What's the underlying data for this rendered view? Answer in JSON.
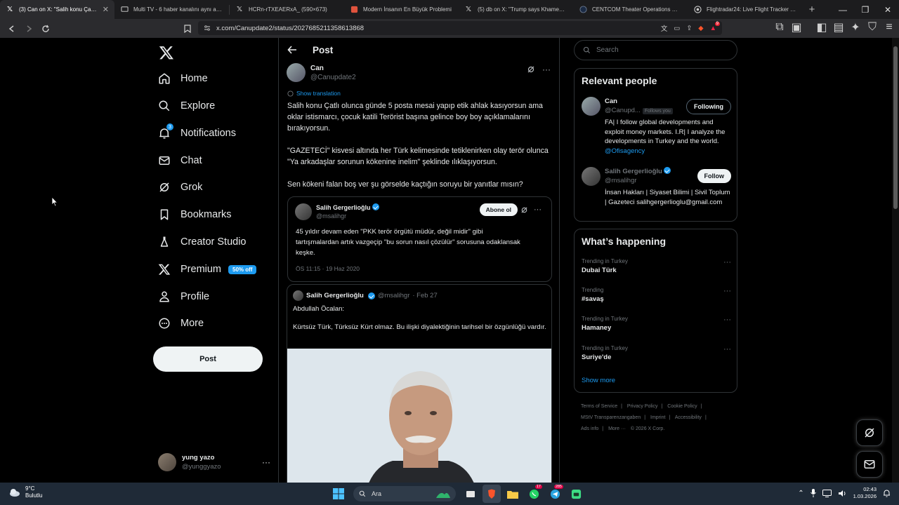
{
  "browser": {
    "tabs": [
      {
        "title": "(3) Can on X: \"Salih konu Çatlı olunca",
        "favicon": "x-icon",
        "active": true
      },
      {
        "title": "Multi TV - 6 haber kanalını aynı anda",
        "favicon": "tv-icon",
        "active": false
      },
      {
        "title": "HCRn-rTXEAERxA_ (590×673)",
        "favicon": "x-icon",
        "active": false
      },
      {
        "title": "Modern İnsanın En Büyük Problemi",
        "favicon": "page-icon",
        "active": false
      },
      {
        "title": "(5) db on X: \"Trump says Khamenei is",
        "favicon": "x-icon",
        "active": false
      },
      {
        "title": "CENTCOM Theater Operations Map",
        "favicon": "globe-icon",
        "active": false
      },
      {
        "title": "Flightradar24: Live Flight Tracker - Re",
        "favicon": "radar-icon",
        "active": false
      }
    ],
    "url": "x.com/Canupdate2/status/2027685211358613868",
    "shield_badge": "9"
  },
  "sidebar": {
    "nav": [
      {
        "label": "Home",
        "icon": "home-icon"
      },
      {
        "label": "Explore",
        "icon": "search-icon"
      },
      {
        "label": "Notifications",
        "icon": "bell-icon",
        "badge": "3"
      },
      {
        "label": "Chat",
        "icon": "mail-icon"
      },
      {
        "label": "Grok",
        "icon": "grok-icon"
      },
      {
        "label": "Bookmarks",
        "icon": "bookmark-icon"
      },
      {
        "label": "Creator Studio",
        "icon": "flask-icon"
      },
      {
        "label": "Premium",
        "icon": "x-icon",
        "promo": "50% off"
      },
      {
        "label": "Profile",
        "icon": "person-icon"
      },
      {
        "label": "More",
        "icon": "more-circle-icon"
      }
    ],
    "post_button": "Post",
    "account": {
      "name": "yung yazo",
      "handle": "@yunggyazo",
      "menu": "···"
    }
  },
  "main": {
    "header_title": "Post",
    "author": {
      "name": "Can",
      "handle": "@Canupdate2"
    },
    "show_translation": "Show translation",
    "paragraphs": [
      "Salih konu Çatlı olunca günde 5 posta mesai yapıp etik ahlak kasıyorsun ama oklar istismarcı, çocuk katili Terörist başına gelince boy boy açıklamalarını bırakıyorsun.",
      "\"GAZETECİ\" kisvesi altında her Türk kelimesinde tetiklenirken olay terör olunca \"Ya arkadaşlar sorunun kökenine inelim\" şeklinde ılıklaşıyorsun.",
      "Sen kökeni falan boş ver şu görselde kaçtığın soruyu bir yanıtlar mısın?"
    ],
    "quote1": {
      "name": "Salih Gergerlioğlu",
      "handle": "@msalihgr",
      "button": "Abone ol",
      "text": "45 yıldır devam eden \"PKK terör örgütü müdür, değil midir\" gibi tartışmalardan artık vazgeçip \"bu sorun nasıl çözülür\" sorusuna odaklansak keşke.",
      "date": "ÖS 11:15 · 19 Haz 2020"
    },
    "quote2": {
      "name": "Salih Gergerlioğlu",
      "handle": "@msalihgr",
      "date": "· Feb 27",
      "lines": [
        "Abdullah Öcalan:",
        "Kürtsüz Türk, Türksüz Kürt olmaz. Bu ilişki diyalektiğinin tarihsel bir özgünlüğü vardır."
      ]
    }
  },
  "right": {
    "search_placeholder": "Search",
    "relevant_title": "Relevant people",
    "people": [
      {
        "name": "Can",
        "handle": "@Canupd...",
        "follows_you": "Follows you",
        "button": "Following",
        "bio": "FA| I follow global developments and exploit money markets. I.R| I analyze the developments in Turkey and the world.",
        "bio_link": "@Ofisagency"
      },
      {
        "name": "Salih Gergerlioğlu",
        "handle": "@msalihgr",
        "button": "Follow",
        "bio": "İnsan Hakları | Siyaset Bilimi | Sivil Toplum | Gazeteci salihgergerlioglu@gmail.com",
        "bio_link": ""
      }
    ],
    "happening_title": "What’s happening",
    "trends": [
      {
        "context": "Trending in Turkey",
        "name": "Dubai Türk"
      },
      {
        "context": "Trending",
        "name": "#savaş"
      },
      {
        "context": "Trending in Turkey",
        "name": "Hamaney"
      },
      {
        "context": "Trending in Turkey",
        "name": "Suriye'de"
      }
    ],
    "show_more": "Show more",
    "footer": [
      "Terms of Service",
      "|",
      "Privacy Policy",
      "|",
      "Cookie Policy",
      "|",
      "MStV Transparenzangaben",
      "|",
      "Imprint",
      "|",
      "Accessibility",
      "|",
      "Ads info",
      "|",
      "More ···",
      "© 2026 X Corp."
    ]
  },
  "taskbar": {
    "weather_temp": "9°C",
    "weather_desc": "Bulutlu",
    "search_label": "Ara",
    "time": "02:43",
    "date": "1.03.2026",
    "badges": {
      "whatsapp": "17",
      "telegram": "285"
    }
  }
}
